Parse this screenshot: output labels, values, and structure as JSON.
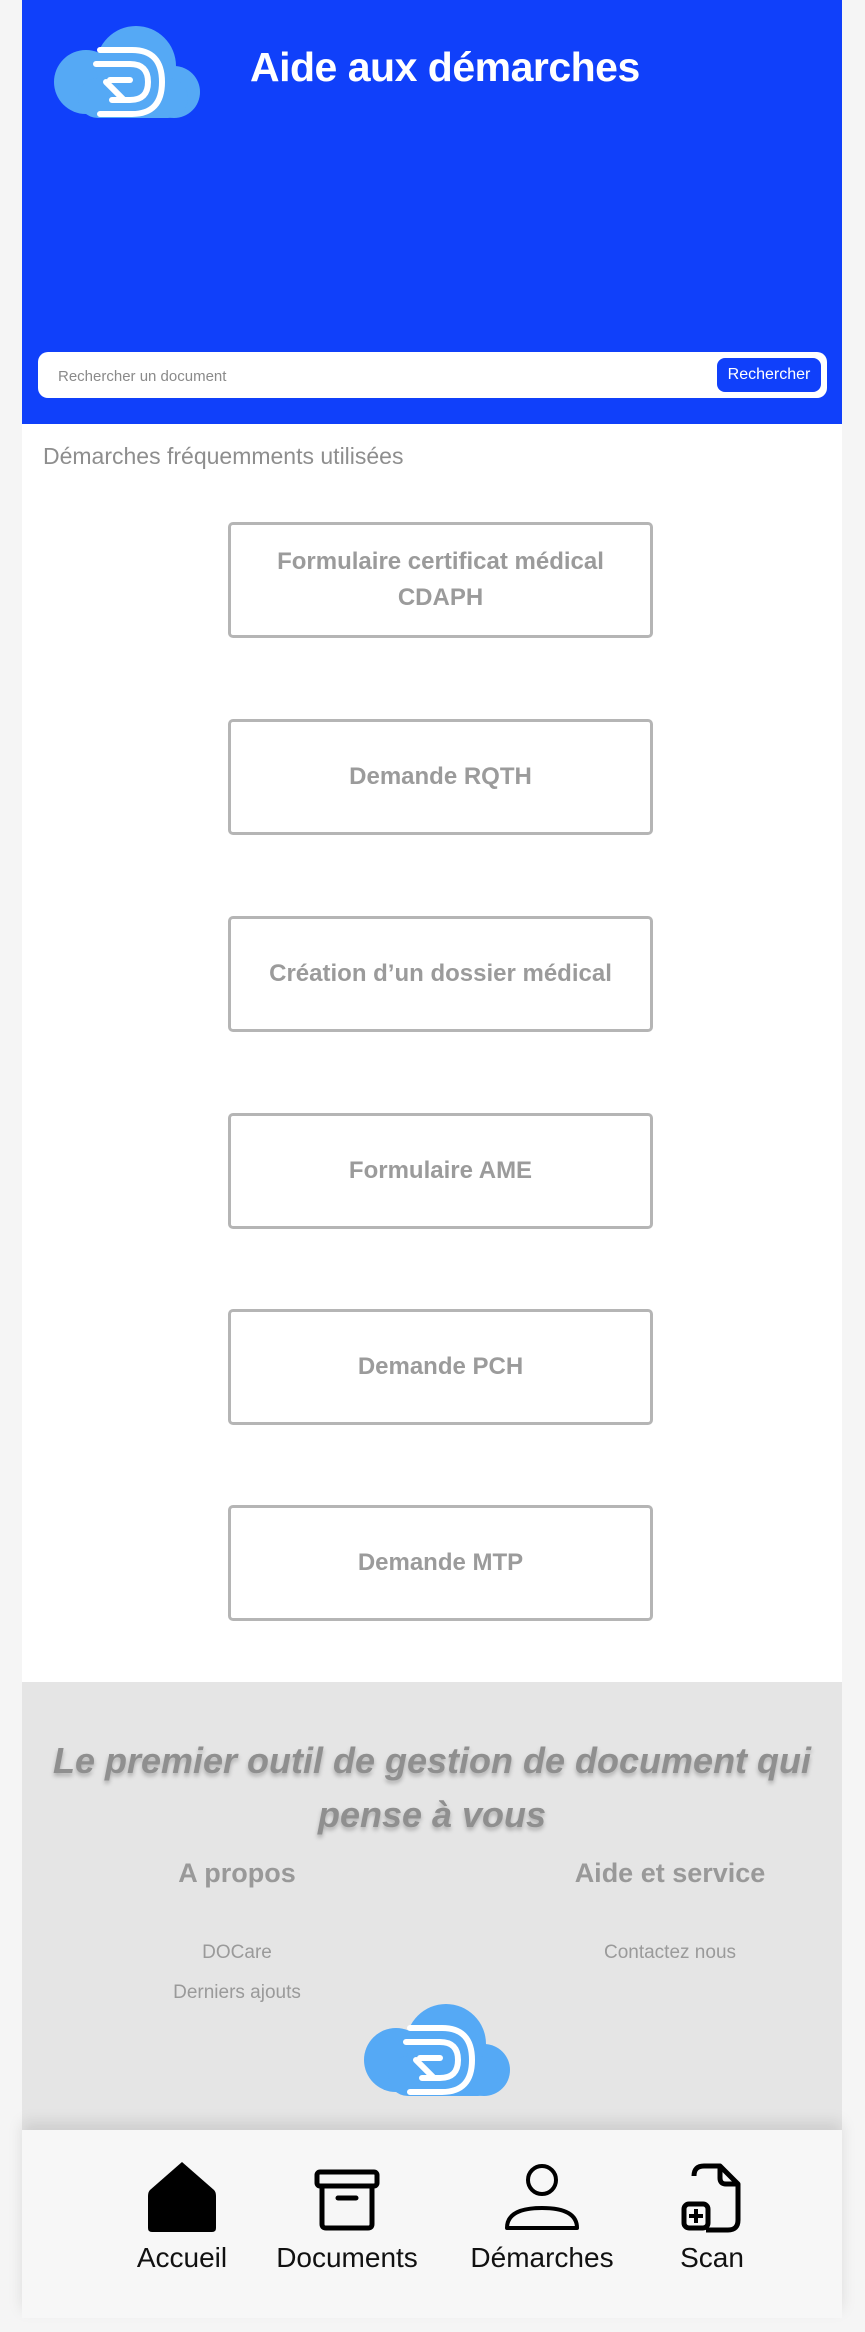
{
  "header": {
    "title": "Aide aux démarches",
    "logo_icon": "docare-cloud-logo-icon",
    "accent_color": "#1040fa"
  },
  "search": {
    "placeholder": "Rechercher un document",
    "button_label": "Rechercher"
  },
  "main": {
    "section_title": "Démarches fréquemments utilisées",
    "procedures": [
      {
        "label": "Formulaire certificat médical CDAPH"
      },
      {
        "label": "Demande RQTH"
      },
      {
        "label": "Création d’un dossier médical"
      },
      {
        "label": "Formulaire AME"
      },
      {
        "label": "Demande PCH"
      },
      {
        "label": "Demande MTP"
      }
    ]
  },
  "footer": {
    "tagline": "Le  premier outil de gestion de document qui pense à vous",
    "about": {
      "title": "A propos",
      "links": [
        "DOCare",
        "Derniers ajouts"
      ]
    },
    "help": {
      "title": "Aide et service",
      "links": [
        "Contactez nous"
      ]
    },
    "logo_icon": "docare-cloud-logo-icon"
  },
  "bottom_nav": {
    "items": [
      {
        "label": "Accueil",
        "icon": "home-icon"
      },
      {
        "label": "Documents",
        "icon": "archive-box-icon"
      },
      {
        "label": "Démarches",
        "icon": "user-icon"
      },
      {
        "label": "Scan",
        "icon": "document-add-icon"
      }
    ]
  }
}
